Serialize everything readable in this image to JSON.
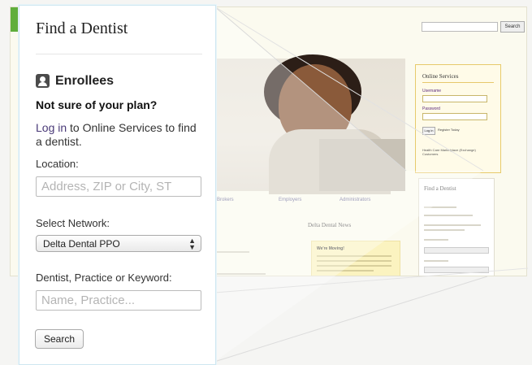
{
  "panel": {
    "title": "Find a Dentist",
    "enrollees": "Enrollees",
    "not_sure": "Not sure of your plan?",
    "login_link": "Log in",
    "login_rest": " to Online Services to find a dentist.",
    "location_label": "Location:",
    "location_placeholder": "Address, ZIP or City, ST",
    "network_label": "Select Network:",
    "network_value": "Delta Dental PPO",
    "keyword_label": "Dentist, Practice or Keyword:",
    "keyword_placeholder": "Name, Practice...",
    "search_label": "Search"
  },
  "background": {
    "search_button": "Search",
    "online_services": {
      "title": "Online Services",
      "username": "Username",
      "password": "Password",
      "login": "Log in",
      "register": "Register Today",
      "health_care": "Health Care Marketplace (Exchange) Customers"
    },
    "nav": [
      "Brokers",
      "Employers",
      "Administrators"
    ],
    "news_title": "Delta Dental News",
    "news_box_title": "We're Moving!",
    "mini_find_title": "Find a Dentist"
  },
  "colors": {
    "accent_link": "#4a3a78",
    "green_strip": "#5fae3c",
    "online_services_border": "#e7ca6b"
  }
}
